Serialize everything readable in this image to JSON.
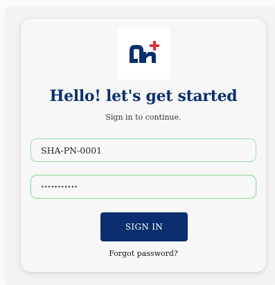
{
  "login": {
    "title": "Hello! let's get started",
    "subtitle": "Sign in to continue.",
    "username_value": "SHA-PN-0001",
    "password_value": "•••••••••••",
    "signin_label": "SIGN IN",
    "forgot_label": "Forgot password?"
  },
  "colors": {
    "brand_navy": "#0b2f6e",
    "brand_red": "#e0313c",
    "field_border": "#9fdcae"
  },
  "icons": {
    "logo": "brand-logo"
  }
}
